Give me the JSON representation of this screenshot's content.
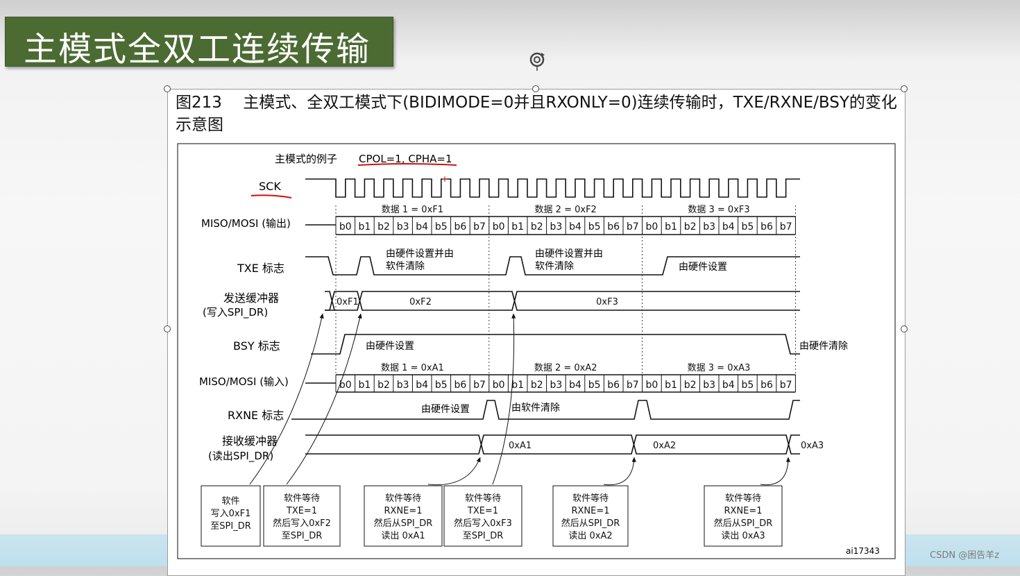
{
  "slide": {
    "title": "主模式全双工连续传输"
  },
  "figure": {
    "caption": "图213　 主模式、全双工模式下(BIDIMODE=0并且RXONLY=0)连续传输时，TXE/RXNE/BSY的变化示意图",
    "example_label": "主模式的例子",
    "cpol_cpha": "CPOL=1, CPHA=1",
    "id": "ai17343",
    "signals": {
      "sck": "SCK",
      "miso_mosi_out": "MISO/MOSI (输出)",
      "txe": "TXE 标志",
      "tx_buf_1": "发送缓冲器",
      "tx_buf_2": "(写入SPI_DR)",
      "bsy": "BSY 标志",
      "miso_mosi_in": "MISO/MOSI (输入)",
      "rxne": "RXNE 标志",
      "rx_buf_1": "接收缓冲器",
      "rx_buf_2": "(读出SPI_DR)"
    },
    "bits": [
      "b0",
      "b1",
      "b2",
      "b3",
      "b4",
      "b5",
      "b6",
      "b7"
    ],
    "data_out": [
      "数据 1 = 0xF1",
      "数据 2 = 0xF2",
      "数据 3 = 0xF3"
    ],
    "data_in": [
      "数据 1 = 0xA1",
      "数据 2 = 0xA2",
      "数据 3 = 0xA3"
    ],
    "tx_values": [
      "0xF1",
      "0xF2",
      "0xF3"
    ],
    "rx_values": [
      "0xA1",
      "0xA2",
      "0xA3"
    ],
    "notes": {
      "txe_set_clear_1": "由硬件设置并由",
      "txe_set_clear_2": "软件清除",
      "txe_set": "由硬件设置",
      "bsy_set": "由硬件设置",
      "bsy_clear": "由硬件清除",
      "rxne_set": "由硬件设置",
      "rxne_clear": "由软件清除"
    },
    "boxes": [
      [
        "软件",
        "写入0xF1",
        "至SPI_DR"
      ],
      [
        "软件等待",
        "TXE=1",
        "然后写入0xF2",
        "至SPI_DR"
      ],
      [
        "软件等待",
        "RXNE=1",
        "然后从SPI_DR",
        "读出 0xA1"
      ],
      [
        "软件等待",
        "TXE=1",
        "然后写入0xF3",
        "至SPI_DR"
      ],
      [
        "软件等待",
        "RXNE=1",
        "然后从SPI_DR",
        "读出 0xA2"
      ],
      [
        "软件等待",
        "RXNE=1",
        "然后从SPI_DR",
        "读出 0xA3"
      ]
    ]
  },
  "watermark": "CSDN @困告羊z"
}
